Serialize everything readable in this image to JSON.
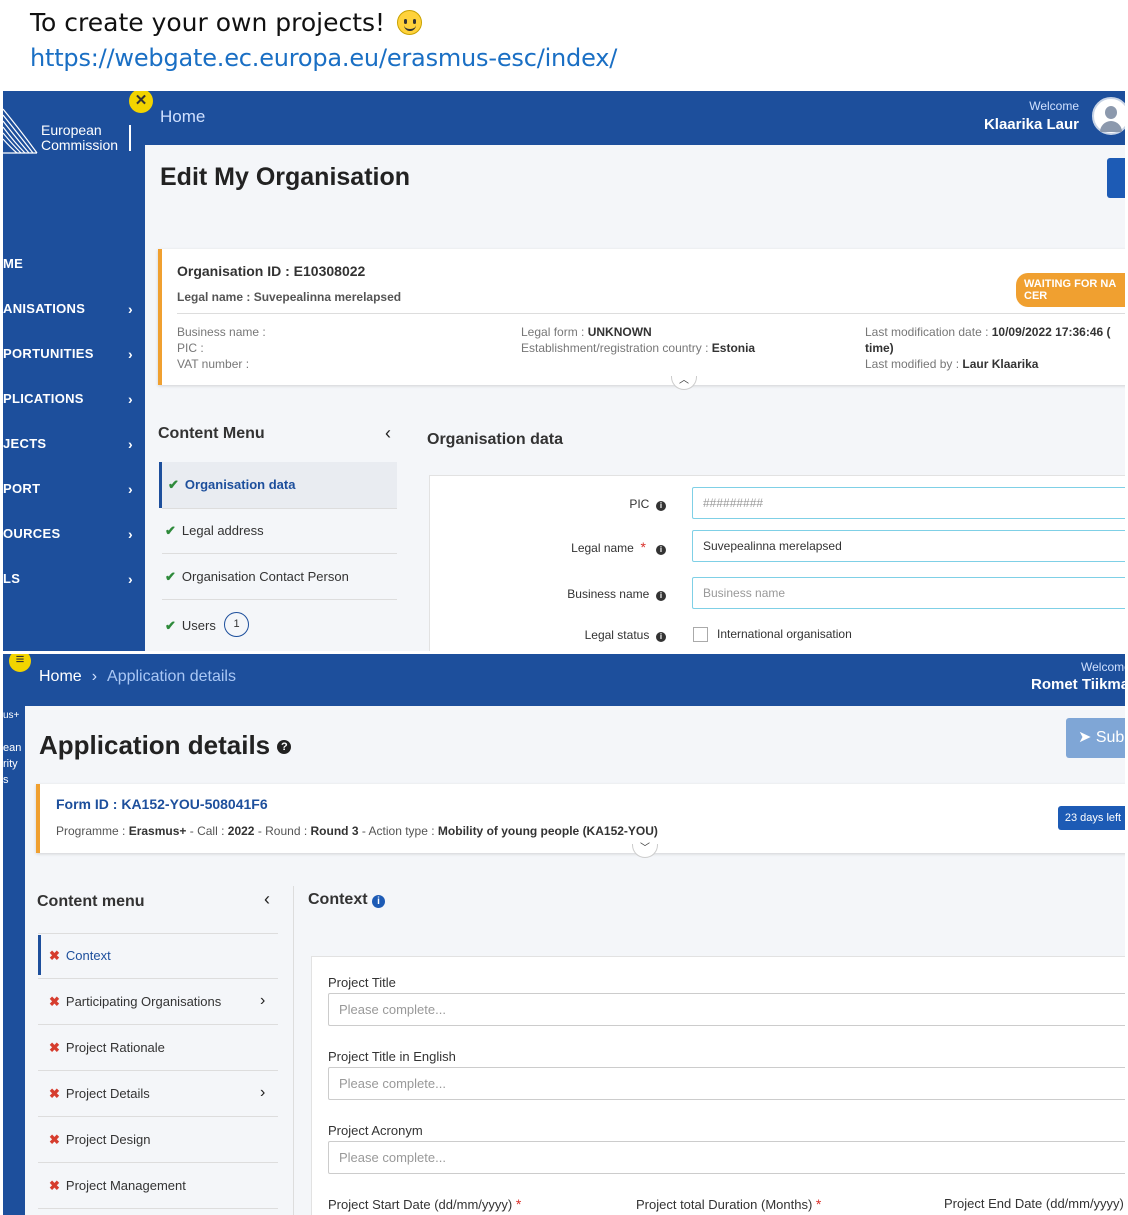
{
  "caption": {
    "text": "To create your own projects!",
    "emoji": "smiley-face-icon",
    "link": "https://webgate.ec.europa.eu/erasmus-esc/index/"
  },
  "screen1": {
    "logo_line1": "European",
    "logo_line2": "Commission",
    "close_badge": "✕",
    "home": "Home",
    "welcome_label": "Welcome",
    "user_name": "Klaarika Laur",
    "nav": [
      "ME",
      "ANISATIONS",
      "PORTUNITIES",
      "PLICATIONS",
      "JECTS",
      "PORT",
      "OURCES",
      "LS"
    ],
    "page_title": "Edit My Organisation",
    "org": {
      "id_label": "Organisation ID : E10308022",
      "legal_name": "Legal name : Suvepealinna merelapsed",
      "status": "WAITING FOR NA CER",
      "business_name_label": "Business name :",
      "pic_label": "PIC :",
      "vat_label": "VAT number :",
      "legal_form_label": "Legal form :",
      "legal_form_value": "UNKNOWN",
      "country_label": "Establishment/registration country :",
      "country_value": "Estonia",
      "lastmod_label": "Last modification date :",
      "lastmod_value": "10/09/2022 17:36:46 (",
      "lastmod_value2": "time)",
      "lastby_label": "Last modified by :",
      "lastby_value": "Laur Klaarika"
    },
    "content_menu_title": "Content Menu",
    "content_menu": [
      {
        "label": "Organisation data",
        "active": true
      },
      {
        "label": "Legal address"
      },
      {
        "label": "Organisation Contact Person"
      },
      {
        "label": "Users",
        "count": "1"
      }
    ],
    "section_title": "Organisation data",
    "form": {
      "pic_label": "PIC",
      "pic_value": "#########",
      "legal_name_label": "Legal name",
      "legal_name_value": "Suvepealinna merelapsed",
      "business_name_label": "Business name",
      "business_name_placeholder": "Business name",
      "legal_status_label": "Legal status",
      "intl_org_label": "International organisation"
    }
  },
  "screen2": {
    "menu_badge": "≡",
    "side_fragments": [
      "us+",
      "ean",
      "rity",
      "s"
    ],
    "home": "Home",
    "breadcrumb_current": "Application details",
    "welcome_label": "Welcome",
    "user_name": "Romet Tiikmaa",
    "page_title": "Application details",
    "help_icon": "?",
    "submit_label": "Sub",
    "form_id": "Form ID : KA152-YOU-508041F6",
    "programme_label": "Programme :",
    "programme_value": "Erasmus+",
    "call_label": "- Call :",
    "call_value": "2022",
    "round_label": "- Round :",
    "round_value": "Round 3",
    "action_label": "- Action type :",
    "action_value": "Mobility of young people (KA152-YOU)",
    "days_left": "23 days left",
    "content_menu_title": "Content menu",
    "content_menu": [
      {
        "label": "Context",
        "active": true
      },
      {
        "label": "Participating Organisations",
        "sub": true
      },
      {
        "label": "Project Rationale"
      },
      {
        "label": "Project Details",
        "sub": true
      },
      {
        "label": "Project Design"
      },
      {
        "label": "Project Management"
      }
    ],
    "section_title": "Context",
    "fields": [
      {
        "label": "Project Title",
        "placeholder": "Please complete..."
      },
      {
        "label": "Project Title in English",
        "placeholder": "Please complete..."
      },
      {
        "label": "Project Acronym",
        "placeholder": "Please complete..."
      }
    ],
    "start_date_label": "Project Start Date (dd/mm/yyyy)",
    "duration_label": "Project total Duration (Months)",
    "end_date_label": "Project End Date (dd/mm/yyyy)"
  }
}
